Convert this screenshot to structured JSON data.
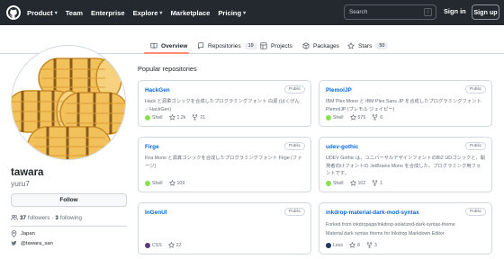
{
  "header": {
    "nav": [
      {
        "label": "Product",
        "dropdown": true
      },
      {
        "label": "Team",
        "dropdown": false
      },
      {
        "label": "Enterprise",
        "dropdown": false
      },
      {
        "label": "Explore",
        "dropdown": true
      },
      {
        "label": "Marketplace",
        "dropdown": false
      },
      {
        "label": "Pricing",
        "dropdown": true
      }
    ],
    "search_placeholder": "Search",
    "search_shortcut": "/",
    "sign_in": "Sign in",
    "sign_up": "Sign up"
  },
  "tabs": [
    {
      "label": "Overview",
      "count": null,
      "icon": "book-icon",
      "active": true
    },
    {
      "label": "Repositories",
      "count": "19",
      "icon": "repo-icon",
      "active": false
    },
    {
      "label": "Projects",
      "count": null,
      "icon": "table-icon",
      "active": false
    },
    {
      "label": "Packages",
      "count": null,
      "icon": "package-icon",
      "active": false
    },
    {
      "label": "Stars",
      "count": "50",
      "icon": "star-icon",
      "active": false
    }
  ],
  "profile": {
    "name": "tawara",
    "login": "yuru7",
    "follow_label": "Follow",
    "followers_count": "37",
    "followers_label": "followers",
    "separator": "·",
    "following_count": "3",
    "following_label": "following",
    "location": "Japan",
    "twitter": "@tawara_san"
  },
  "popular": {
    "title": "Popular repositories",
    "repos": [
      {
        "name": "HackGen",
        "visibility": "Public",
        "description": "Hack と源柔ゴシックを合成したプログラミングフォント 白源 (はくげん／HackGen)",
        "language": "Shell",
        "language_color": "#89e051",
        "stars": "1.2k",
        "forks": "21"
      },
      {
        "name": "PlemolJP",
        "visibility": "Public",
        "description": "IBM Plex Mono と IBM Plex Sans JP を合成したプログラミングフォント PlemolJP (プレモル ジェイピー)",
        "language": "Shell",
        "language_color": "#89e051",
        "stars": "575",
        "forks": "6"
      },
      {
        "name": "Firge",
        "visibility": "Public",
        "description": "Fira Mono と源真ゴシックを合成したプログラミングフォント Firge (ファージ)",
        "language": "Shell",
        "language_color": "#89e051",
        "stars": "109",
        "forks": null
      },
      {
        "name": "udev-gothic",
        "visibility": "Public",
        "description": "UDEV Gothic は、ユニバーサルデザインフォントのBIZ UDゴシックと、開発者向けフォントの JetBrains Mono を合成した、プログラミング用フォントです。",
        "language": "Shell",
        "language_color": "#89e051",
        "stars": "102",
        "forks": "1"
      },
      {
        "name": "InGenUI",
        "visibility": "Public",
        "description": "",
        "language": "CSS",
        "language_color": "#563d7c",
        "stars": "22",
        "forks": null
      },
      {
        "name": "inkdrop-material-dark-mod-syntax",
        "visibility": "Public",
        "description": "Forked from inkdropapp/inkdrop-solarized-dark-syntax-theme\nMaterial dark syntax theme for Inkdrop Markdown Editor",
        "language": "Less",
        "language_color": "#1d365d",
        "stars": "8",
        "forks": "3"
      }
    ]
  },
  "colors": {
    "header_bg": "#24292f",
    "link": "#0969da",
    "tab_underline": "#fd8c73",
    "muted": "#656d76"
  }
}
